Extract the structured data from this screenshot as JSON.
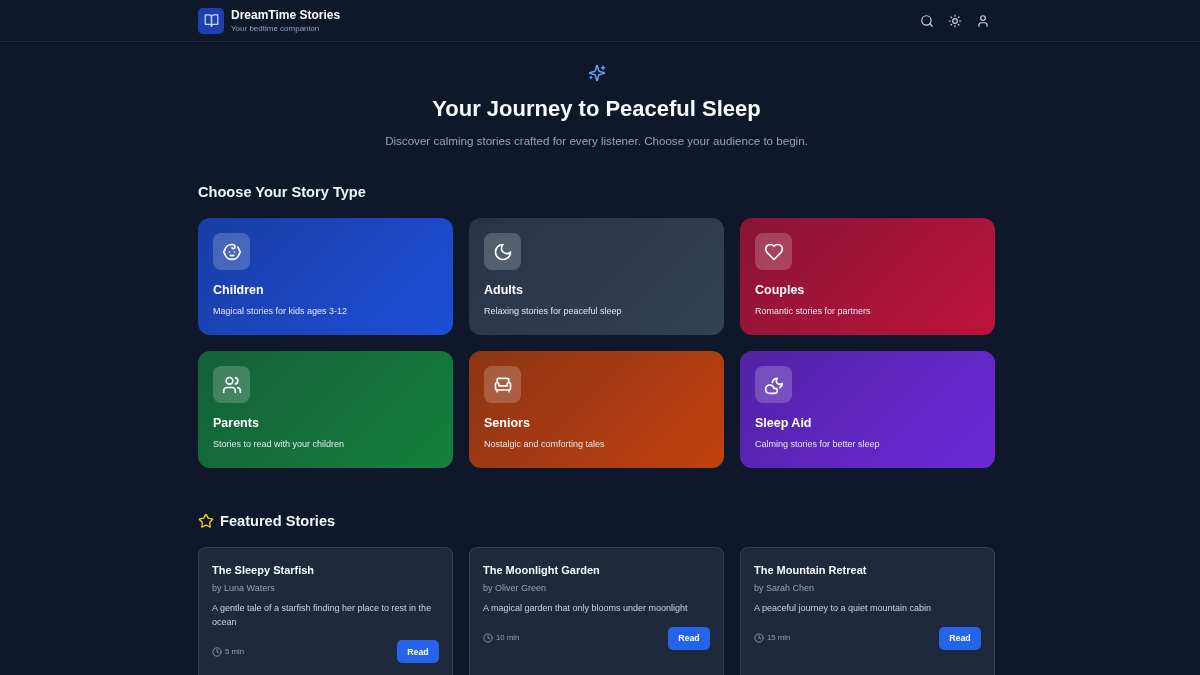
{
  "header": {
    "title": "DreamTime Stories",
    "subtitle": "Your bedtime companion"
  },
  "hero": {
    "heading": "Your Journey to Peaceful Sleep",
    "text": "Discover calming stories crafted for every listener. Choose your audience to begin."
  },
  "story_types": {
    "heading": "Choose Your Story Type",
    "items": [
      {
        "kind": "face",
        "title": "Children",
        "description": "Magical stories for kids ages 3-12",
        "color": "#1d4ed8"
      },
      {
        "kind": "moon",
        "title": "Adults",
        "description": "Relaxing stories for peaceful sleep",
        "color": "#334155"
      },
      {
        "kind": "heart",
        "title": "Couples",
        "description": "Romantic stories for partners",
        "color": "#be123c"
      },
      {
        "kind": "people",
        "title": "Parents",
        "description": "Stories to read with your children",
        "color": "#15803d"
      },
      {
        "kind": "armchair",
        "title": "Seniors",
        "description": "Nostalgic and comforting tales",
        "color": "#c2410c"
      },
      {
        "kind": "cloud",
        "title": "Sleep Aid",
        "description": "Calming stories for better sleep",
        "color": "#6d28d9"
      }
    ]
  },
  "featured": {
    "heading": "Featured Stories",
    "stories": [
      {
        "title": "The Sleepy Starfish",
        "author": "by Luna Waters",
        "description": "A gentle tale of a starfish finding her place to rest in the ocean",
        "duration": "5 min",
        "button": "Read"
      },
      {
        "title": "The Moonlight Garden",
        "author": "by Oliver Green",
        "description": "A magical garden that only blooms under moonlight",
        "duration": "10 min",
        "button": "Read"
      },
      {
        "title": "The Mountain Retreat",
        "author": "by Sarah Chen",
        "description": "A peaceful journey to a quiet mountain cabin",
        "duration": "15 min",
        "button": "Read"
      }
    ]
  }
}
